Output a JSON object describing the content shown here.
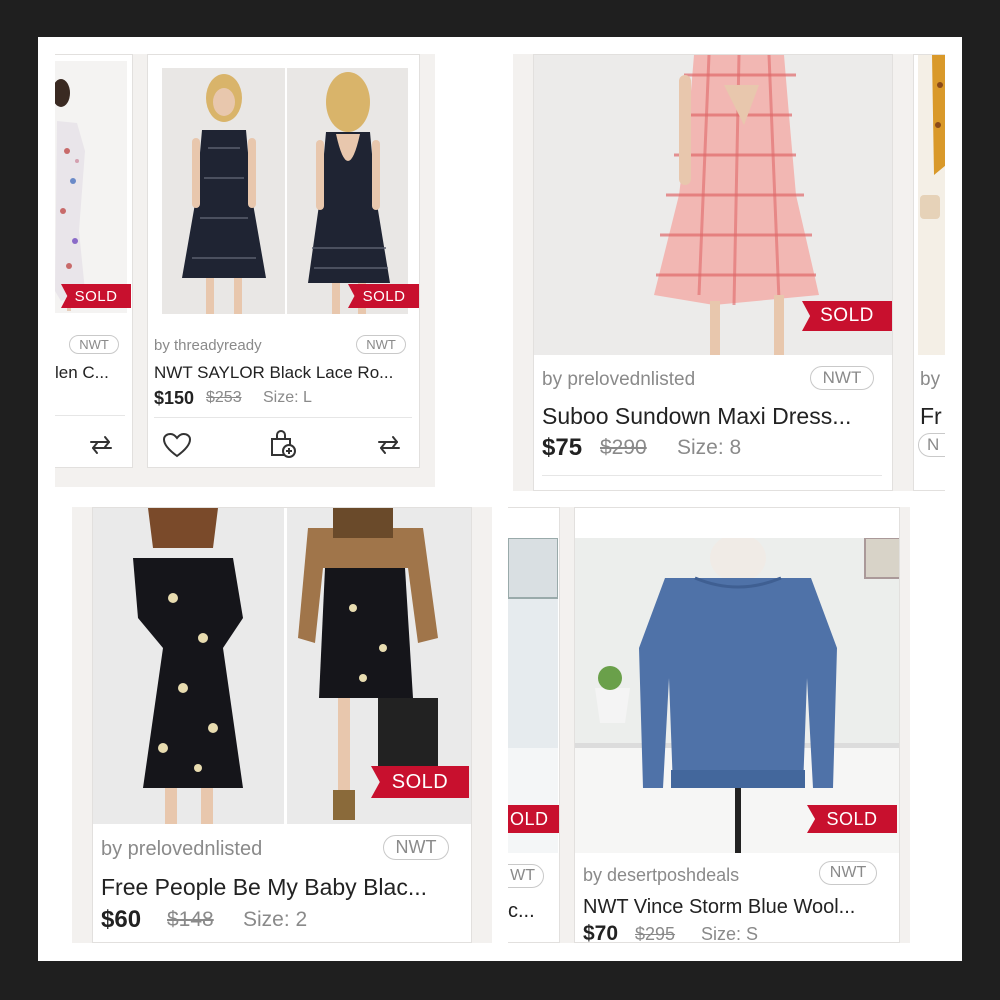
{
  "colors": {
    "sold_red": "#c8102e",
    "text_dark": "#222222",
    "text_gray": "#8a8a8a",
    "frame": "#1f1f1f"
  },
  "tl": {
    "left_card": {
      "title": "len C...",
      "nwt": "NWT",
      "sold": "SOLD"
    },
    "card": {
      "seller": "by threadyready",
      "nwt": "NWT",
      "title": "NWT SAYLOR Black Lace Ro...",
      "price": "$150",
      "original_price": "$253",
      "size": "Size: L",
      "sold": "SOLD",
      "icons": [
        "heart-icon",
        "bundle-icon",
        "share-icon"
      ]
    }
  },
  "tr": {
    "card": {
      "seller": "by prelovednlisted",
      "nwt": "NWT",
      "title": "Suboo Sundown Maxi Dress...",
      "price": "$75",
      "original_price": "$290",
      "size": "Size: 8",
      "sold": "SOLD"
    },
    "right_card": {
      "seller": "by",
      "title": "Fr",
      "nwt": "N"
    }
  },
  "bl": {
    "card": {
      "seller": "by prelovednlisted",
      "nwt": "NWT",
      "title": "Free People Be My Baby Blac...",
      "price": "$60",
      "original_price": "$148",
      "size": "Size: 2",
      "sold": "SOLD"
    }
  },
  "br": {
    "left_card": {
      "sold": "OLD",
      "nwt": "WT",
      "title": "c..."
    },
    "card": {
      "seller": "by desertposhdeals",
      "nwt": "NWT",
      "title": "NWT Vince Storm Blue Wool...",
      "price": "$70",
      "original_price": "$295",
      "size": "Size: S",
      "sold": "SOLD"
    }
  }
}
